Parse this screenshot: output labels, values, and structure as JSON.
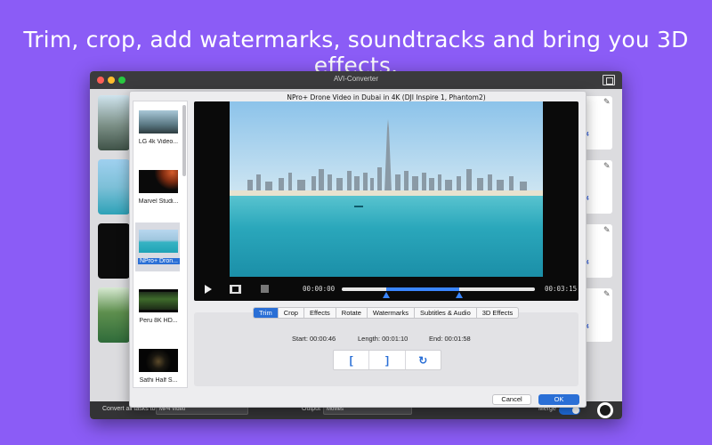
{
  "headline": "Trim, crop, add watermarks, soundtracks and bring you 3D effects.",
  "window": {
    "title": "AVI-Converter"
  },
  "video": {
    "title": "NPro+ Drone Video in Dubai in 4K (DJI Inspire 1, Phantom2)",
    "current_time": "00:00:00",
    "total_time": "00:03:15",
    "progress": 0.0,
    "trim_start_fraction": 0.23,
    "trim_end_fraction": 0.61
  },
  "video_list": [
    {
      "label": "LG 4k Video..."
    },
    {
      "label": "Marvel Studi..."
    },
    {
      "label": "NPro+ Dron...",
      "selected": true
    },
    {
      "label": "Peru 8K HD..."
    },
    {
      "label": "Sathi Half S..."
    }
  ],
  "tabs": [
    "Trim",
    "Crop",
    "Effects",
    "Rotate",
    "Watermarks",
    "Subtitles & Audio",
    "3D Effects"
  ],
  "active_tab": "Trim",
  "trim": {
    "start": "Start: 00:00:46",
    "length": "Length: 00:01:10",
    "end": "End: 00:01:58",
    "set_start_label": "[",
    "set_end_label": "]",
    "reset_label": "↻"
  },
  "buttons": {
    "cancel": "Cancel",
    "ok": "OK"
  },
  "bottom_bar": {
    "convert_label": "Convert all tasks to",
    "convert_value": "MP4 Video",
    "output_label": "Output",
    "output_value": "Movies",
    "merge_label": "Merge",
    "merge_on": true
  },
  "bg_items": [
    {
      "number": "4"
    },
    {
      "number": "4"
    },
    {
      "number": "4"
    },
    {
      "number": "4"
    }
  ],
  "colors": {
    "background": "#8b5cf6",
    "accent": "#2a6fd6",
    "progress": "#3a86ff"
  }
}
